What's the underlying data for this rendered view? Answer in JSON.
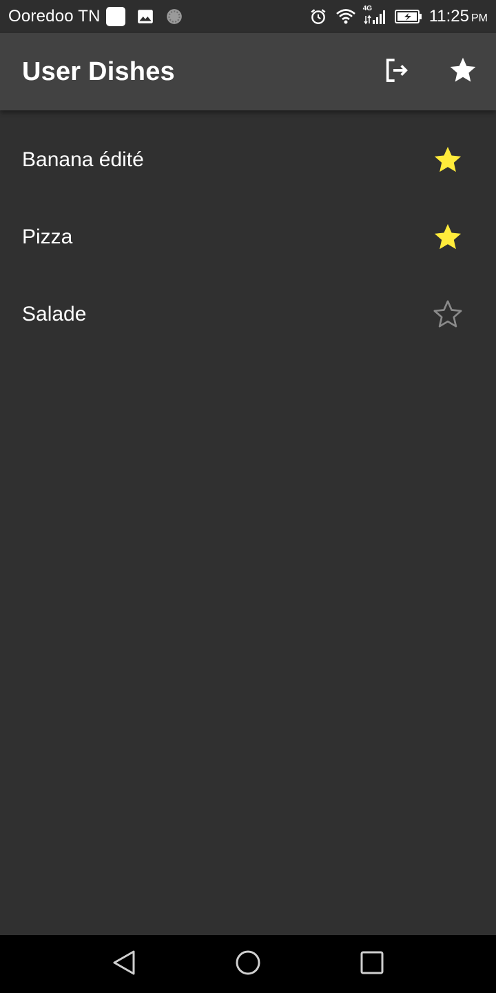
{
  "status_bar": {
    "carrier": "Ooredoo TN",
    "network": "4G",
    "time": "11:25",
    "ampm": "PM",
    "icons": [
      "notification-square-icon",
      "image-icon",
      "sync-circle-icon",
      "alarm-icon",
      "wifi-icon",
      "signal-icon",
      "battery-charging-icon"
    ]
  },
  "app_bar": {
    "title": "User Dishes",
    "actions": [
      "logout-icon",
      "favorites-star-icon"
    ]
  },
  "dishes": [
    {
      "name": "Banana édité",
      "favorite": true
    },
    {
      "name": "Pizza",
      "favorite": true
    },
    {
      "name": "Salade",
      "favorite": false
    }
  ],
  "colors": {
    "background": "#303030",
    "app_bar": "#424242",
    "star_filled": "#FFEB3B",
    "star_outline": "#8a8a8a"
  },
  "nav_bar": {
    "buttons": [
      "back-icon",
      "home-icon",
      "recents-icon"
    ]
  }
}
